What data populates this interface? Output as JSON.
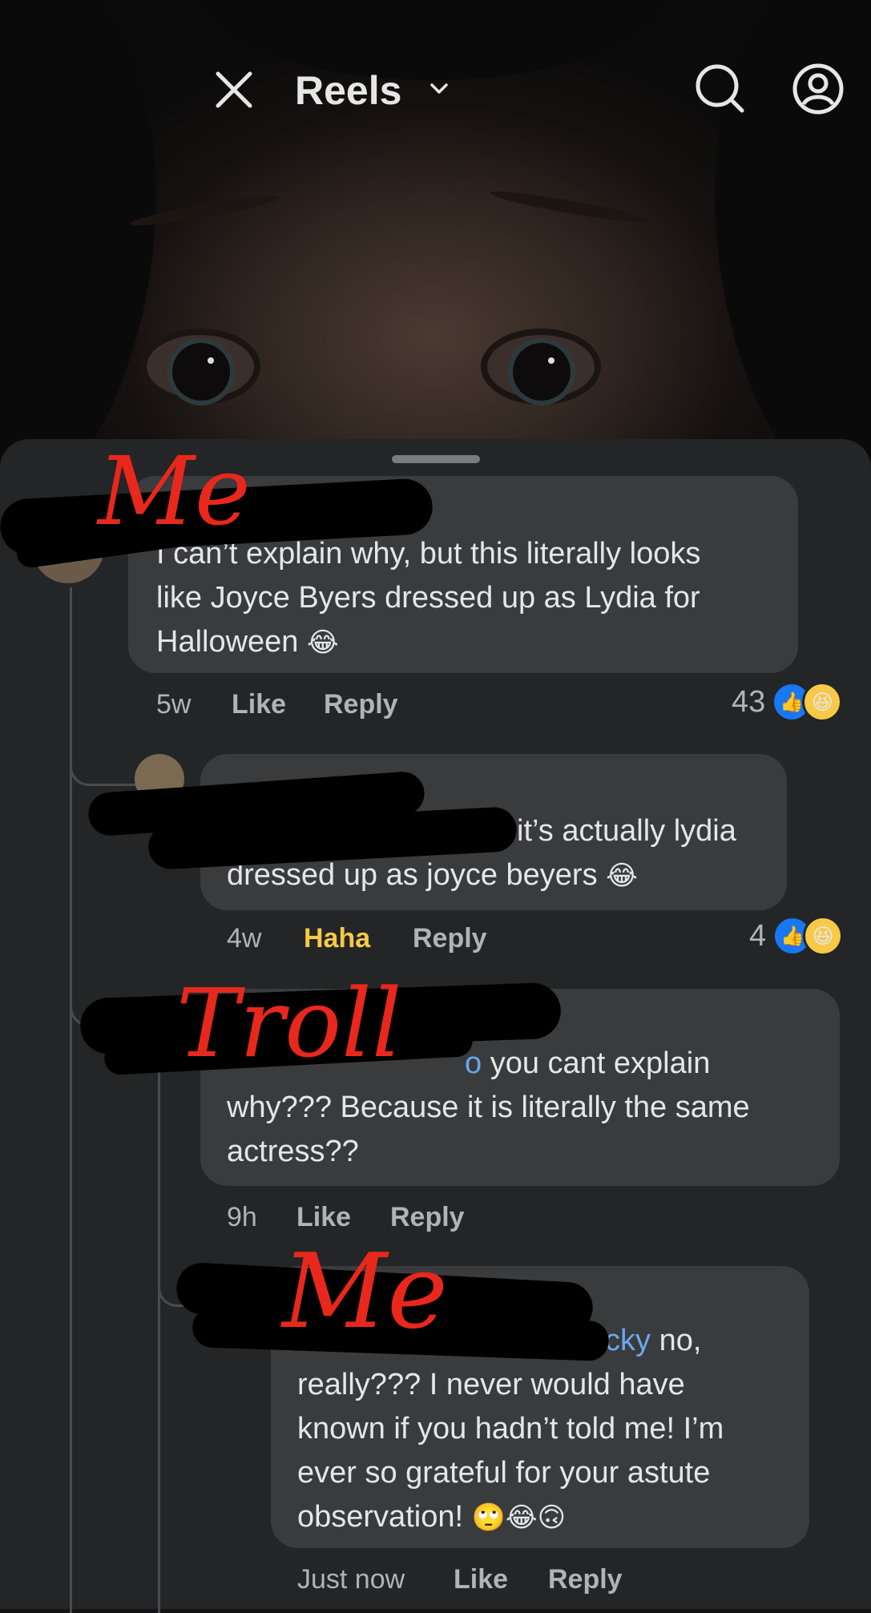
{
  "header": {
    "title": "Reels",
    "close_icon": "close-icon",
    "dropdown_icon": "chevron-down-icon",
    "search_icon": "search-icon",
    "profile_icon": "profile-icon"
  },
  "annotations": {
    "me_top": "Me",
    "troll": "Troll",
    "me_bottom": "Me"
  },
  "comments": [
    {
      "text_lines": [
        "I can’t explain why, but this literally looks",
        "like Joyce Byers dressed up as Lydia for",
        "Halloween"
      ],
      "emoji": "😂",
      "time": "5w",
      "like_label": "Like",
      "reply_label": "Reply",
      "reaction_count": "43"
    },
    {
      "mention_tail": "",
      "text_lines": [
        "it’s actually lydia",
        "dressed up as joyce beyers"
      ],
      "emoji": "😂",
      "time": "4w",
      "like_label": "Haha",
      "reply_label": "Reply",
      "reaction_count": "4"
    },
    {
      "mention_tail": "o",
      "text_lines": [
        "you cant explain",
        "why???  Because it is literally the same",
        "actress??"
      ],
      "time": "9h",
      "like_label": "Like",
      "reply_label": "Reply"
    },
    {
      "mention_tail": "cky",
      "text_lines": [
        "no,",
        "really??? I never would have",
        "known if you hadn’t told me! I’m",
        "ever so grateful for your astute",
        "observation!"
      ],
      "emojis": "🙄😂🙃",
      "time": "Just now",
      "like_label": "Like",
      "reply_label": "Reply"
    }
  ],
  "colors": {
    "sheet": "#242526",
    "bubble": "#3a3b3c",
    "mention": "#6aa7f2",
    "haha": "#f7c948",
    "like_blue": "#1877f2",
    "annotation_red": "#e8281c"
  }
}
